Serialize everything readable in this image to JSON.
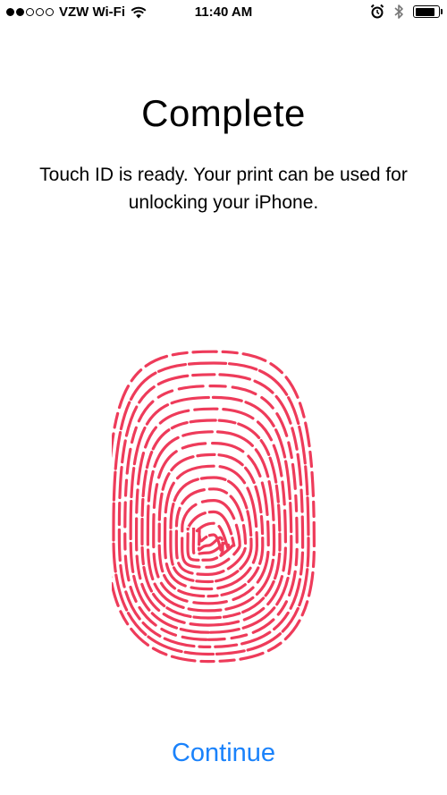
{
  "status_bar": {
    "carrier": "VZW Wi-Fi",
    "time": "11:40 AM",
    "signal_bars_filled": 2,
    "signal_bars_total": 5,
    "battery_level": 0.9
  },
  "title": "Complete",
  "description": "Touch ID is ready. Your print can be used for unlocking your iPhone.",
  "continue_label": "Continue",
  "colors": {
    "fingerprint": "#ee3b5a",
    "accent": "#1a82fb"
  },
  "icons": [
    "wifi-icon",
    "alarm-icon",
    "bluetooth-icon",
    "battery-icon",
    "fingerprint-icon"
  ]
}
